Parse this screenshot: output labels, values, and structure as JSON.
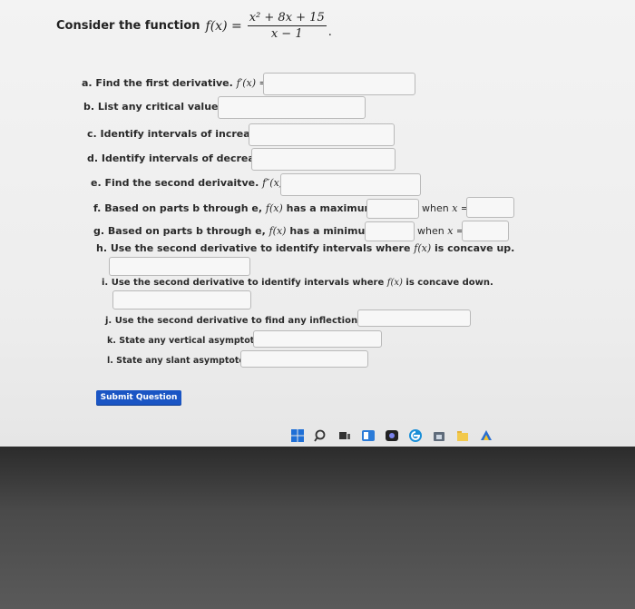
{
  "prompt": {
    "intro": "Consider the function",
    "fx": "f(x) =",
    "numerator": "x² + 8x + 15",
    "denominator": "x − 1",
    "end": "."
  },
  "questions": {
    "a": {
      "text": "a. Find the first derivative.",
      "math": "f′(x) ="
    },
    "b": {
      "text": "b. List any critical values."
    },
    "c": {
      "text": "c. Identify intervals of increase."
    },
    "d": {
      "text": "d. Identify intervals of decrease."
    },
    "e": {
      "text": "e. Find the second derivaitve.",
      "math": "f″(x) ="
    },
    "f": {
      "pre": "f. Based on parts b through e,",
      "math": "f(x)",
      "mid": "has a maximum of",
      "y": "y =",
      "when": "when",
      "x": "x ="
    },
    "g": {
      "pre": "g. Based on parts b through e,",
      "math": "f(x)",
      "mid": "has a minimum of",
      "y": "y =",
      "when": "when",
      "x": "x ="
    },
    "h": {
      "pre": "h. Use the second derivative to identify intervals where",
      "math": "f(x)",
      "post": "is concave up."
    },
    "i": {
      "pre": "i. Use the second derivative to identify intervals where",
      "math": "f(x)",
      "post": "is concave down."
    },
    "j": {
      "text": "j. Use the second derivative to find any inflection points."
    },
    "k": {
      "text": "k. State any vertical asymptotes."
    },
    "l": {
      "text": "l. State any slant asymptotes."
    }
  },
  "submit_label": "Submit Question",
  "taskbar": {
    "icons": [
      "windows-icon",
      "search-icon",
      "task-view-icon",
      "widgets-icon",
      "chat-icon",
      "edge-icon",
      "store-icon",
      "file-explorer-icon",
      "app-icon"
    ]
  }
}
